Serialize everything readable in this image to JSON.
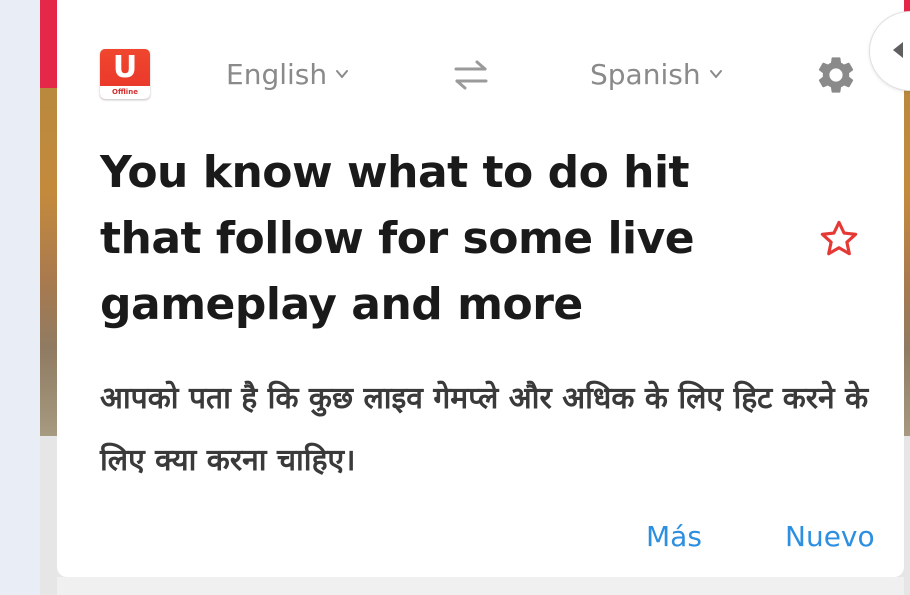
{
  "header": {
    "logo": {
      "letter": "U",
      "badge": "Offline"
    },
    "source_language": "English",
    "target_language": "Spanish",
    "icons": {
      "swap": "swap-arrows-icon",
      "settings": "gear-icon",
      "dropdown": "chevron-down-icon",
      "favorite": "star-outline-icon",
      "collapse": "caret-left-icon"
    }
  },
  "content": {
    "source_text": "You know what to do hit that follow for some live gameplay and more",
    "translation": "आपको पता है कि कुछ लाइव गेमप्ले और अधिक के लिए हिट करने के लिए क्या करना चाहिए।"
  },
  "actions": {
    "more": "Más",
    "new": "Nuevo"
  },
  "colors": {
    "accent_blue": "#2d8fe0",
    "logo_red": "#e8352a",
    "star_red": "#e53935",
    "icon_gray": "#8a8a8a"
  }
}
